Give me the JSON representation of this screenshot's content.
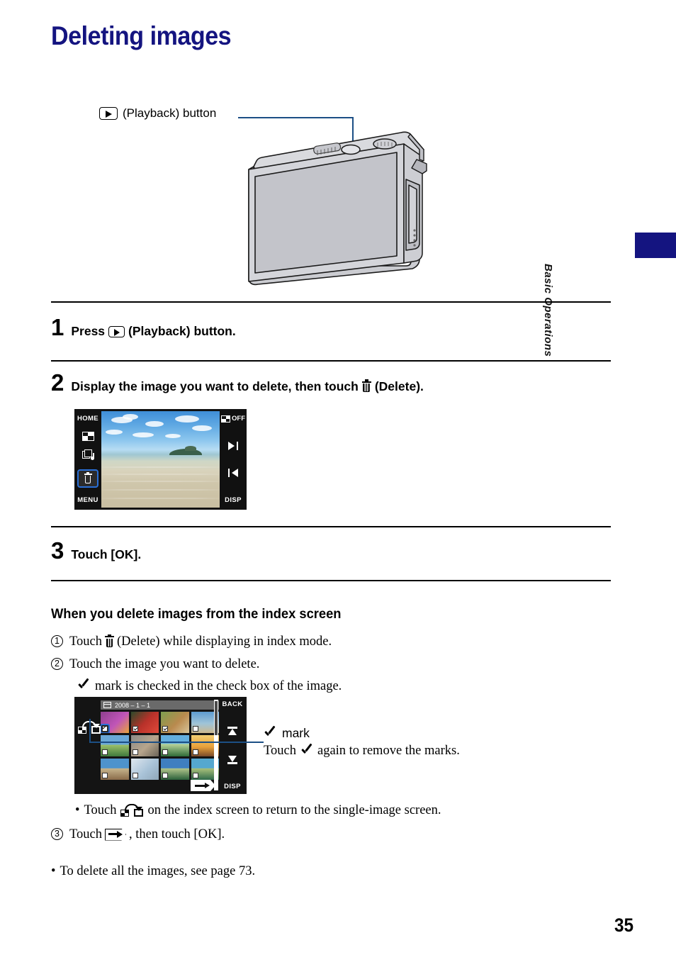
{
  "page": {
    "title": "Deleting images",
    "number": "35",
    "side_tab_label": "Basic Operations",
    "accent_color": "#141480",
    "leader_color": "#1c4f85",
    "highlight_color": "#2a6fd6"
  },
  "callout": {
    "icon": "playback-icon",
    "label": "(Playback) button"
  },
  "steps": [
    {
      "num": "1",
      "parts": [
        "Press",
        "playback-icon",
        "(Playback) button."
      ]
    },
    {
      "num": "2",
      "parts": [
        "Display the image you want to delete, then touch",
        "trash-icon",
        "(Delete)."
      ]
    },
    {
      "num": "3",
      "parts": [
        "Touch [OK]."
      ]
    }
  ],
  "step1": {
    "num": "1",
    "pre": "Press",
    "post": "(Playback) button."
  },
  "step2": {
    "num": "2",
    "pre": "Display the image you want to delete, then touch",
    "post": "(Delete)."
  },
  "step3": {
    "num": "3",
    "text": "Touch [OK]."
  },
  "subhead": "When you delete images from the index screen",
  "list": {
    "item1": {
      "num": "1",
      "pre": "Touch",
      "post": "(Delete) while displaying in index mode."
    },
    "item2": {
      "num": "2",
      "text": "Touch the image you want to delete.",
      "sub": "mark is checked in the check box of the image."
    },
    "bullet1": {
      "pre": "Touch",
      "post": "on the index screen to return to the single-image screen."
    },
    "item3": {
      "num": "3",
      "pre": "Touch",
      "post": ", then touch [OK]."
    },
    "bullet2": {
      "text": "To delete all the images, see page 73."
    }
  },
  "mark_note": {
    "line1": "mark",
    "line2_pre": "Touch",
    "line2_post": "again to remove the marks."
  },
  "lcd_single": {
    "left": {
      "home": "HOME",
      "index_icon": "index-grid-icon",
      "slideshow_icon": "slideshow-icon",
      "delete_icon": "trash-icon",
      "menu": "MENU"
    },
    "right": {
      "burst_off": "OFF",
      "next_icon": "next-image-icon",
      "prev_icon": "previous-image-icon",
      "disp": "DISP"
    }
  },
  "lcd_index": {
    "date": "2008 – 1 – 1",
    "back": "BACK",
    "disp": "DISP",
    "up_icon": "scroll-up-icon",
    "down_icon": "scroll-down-icon",
    "confirm_icon": "arrow-right-icon",
    "return_icon": "return-to-single-icon",
    "thumbnails": [
      {
        "id": "1",
        "checked": true,
        "highlighted": true,
        "colors": [
          "#8e3f8e",
          "#c055b8",
          "#e8a43a"
        ]
      },
      {
        "id": "2",
        "checked": true,
        "highlighted": false,
        "colors": [
          "#2c4a2a",
          "#b8312a",
          "#e04a3a"
        ]
      },
      {
        "id": "3",
        "checked": true,
        "highlighted": false,
        "colors": [
          "#7d9e4f",
          "#b98a4e",
          "#d8c59a"
        ]
      },
      {
        "id": "4",
        "checked": false,
        "highlighted": false,
        "colors": [
          "#5e9cd0",
          "#9fc4d8",
          "#cdb98f"
        ]
      },
      {
        "id": "5",
        "checked": false,
        "highlighted": false,
        "colors": [
          "#6aa8d8",
          "#3f7a3c",
          "#9cc06a"
        ]
      },
      {
        "id": "6",
        "checked": false,
        "highlighted": false,
        "colors": [
          "#8a8a88",
          "#b7a58c",
          "#6b6458"
        ]
      },
      {
        "id": "7",
        "checked": false,
        "highlighted": false,
        "colors": [
          "#63aede",
          "#2f6b38",
          "#b9d39a"
        ]
      },
      {
        "id": "8",
        "checked": false,
        "highlighted": false,
        "colors": [
          "#e8a13a",
          "#7a4a2a",
          "#f2cd72"
        ]
      },
      {
        "id": "9",
        "checked": false,
        "highlighted": false,
        "colors": [
          "#4e93cc",
          "#8a6b4a",
          "#c6b48c"
        ]
      },
      {
        "id": "10",
        "checked": false,
        "highlighted": false,
        "colors": [
          "#a9c3d8",
          "#dfe7ee",
          "#8fa6b8"
        ]
      },
      {
        "id": "11",
        "checked": false,
        "highlighted": false,
        "colors": [
          "#3f7fc0",
          "#2a5f3a",
          "#b0c48a"
        ]
      },
      {
        "id": "12",
        "checked": false,
        "highlighted": false,
        "colors": [
          "#55a8cf",
          "#2f6b4a",
          "#a8c07a"
        ]
      }
    ]
  }
}
